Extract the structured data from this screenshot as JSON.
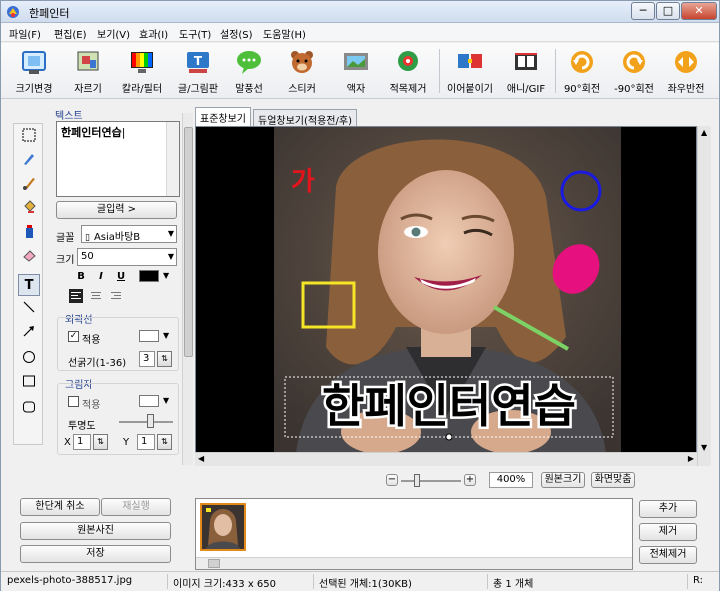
{
  "window": {
    "title": "한페인터",
    "minimize": "─",
    "maximize": "□",
    "close": "✕"
  },
  "menu": [
    "파일(F)",
    "편집(E)",
    "보기(V)",
    "효과(I)",
    "도구(T)",
    "설정(S)",
    "도움말(H)"
  ],
  "toolbar": [
    {
      "label": "크기변경",
      "icon": "resize-icon"
    },
    {
      "label": "자르기",
      "icon": "crop-icon"
    },
    {
      "label": "칼라/필터",
      "icon": "color-filter-icon"
    },
    {
      "label": "글/그림판",
      "icon": "text-draw-icon"
    },
    {
      "label": "말풍선",
      "icon": "speech-bubble-icon"
    },
    {
      "label": "스티커",
      "icon": "sticker-icon"
    },
    {
      "label": "액자",
      "icon": "frame-icon"
    },
    {
      "label": "적목제거",
      "icon": "red-eye-icon"
    },
    {
      "label": "이어붙이기",
      "icon": "merge-icon"
    },
    {
      "label": "애니/GIF",
      "icon": "gif-icon"
    },
    {
      "label": "90°회전",
      "icon": "rotate-cw-icon"
    },
    {
      "label": "-90°회전",
      "icon": "rotate-ccw-icon"
    },
    {
      "label": "좌우반전",
      "icon": "flip-icon"
    }
  ],
  "panel": {
    "text_section": "텍스트",
    "text_value": "한페인터연습",
    "input_button": "글입력 >",
    "font_label": "글꼴",
    "font_value": "Asia바탕B",
    "size_label": "크기",
    "size_value": "50",
    "bold": "B",
    "italic": "I",
    "underline": "U",
    "outline_section": "외곽선",
    "outline_apply": "적용",
    "outline_width_label": "선굵기(1-36)",
    "outline_width_value": "3",
    "shadow_section": "그림자",
    "shadow_apply": "적용",
    "opacity_label": "투명도",
    "x_label": "X",
    "x_value": "1",
    "y_label": "Y",
    "y_value": "1",
    "colors": {
      "text": "#000000",
      "outline": "#ffffff",
      "shadow": "#ffffff"
    }
  },
  "tabs": [
    "표준창보기",
    "듀얼창보기(적용전/후)"
  ],
  "canvas": {
    "overlay_text": "한페인터연습",
    "red_text": "가",
    "colors": {
      "red": "#e3141c",
      "blue": "#1a1ae0",
      "magenta": "#e6117f",
      "yellow": "#f4e526",
      "green": "#7dd266"
    }
  },
  "zoom": {
    "minus": "−",
    "plus": "+",
    "value": "400%",
    "original": "원본크기",
    "fit": "화면맞춤"
  },
  "bottom_left": {
    "undo": "한단계 취소",
    "redo": "재실행",
    "original_photo": "원본사진",
    "save": "저장"
  },
  "bottom_right": {
    "add": "추가",
    "remove": "제거",
    "remove_all": "전체제거"
  },
  "status": {
    "filename": "pexels-photo-388517.jpg",
    "image_size": "이미지 크기:433 x 650",
    "selected": "선택된 개체:1(30KB)",
    "total": "총 1 개체",
    "right": "R:"
  }
}
